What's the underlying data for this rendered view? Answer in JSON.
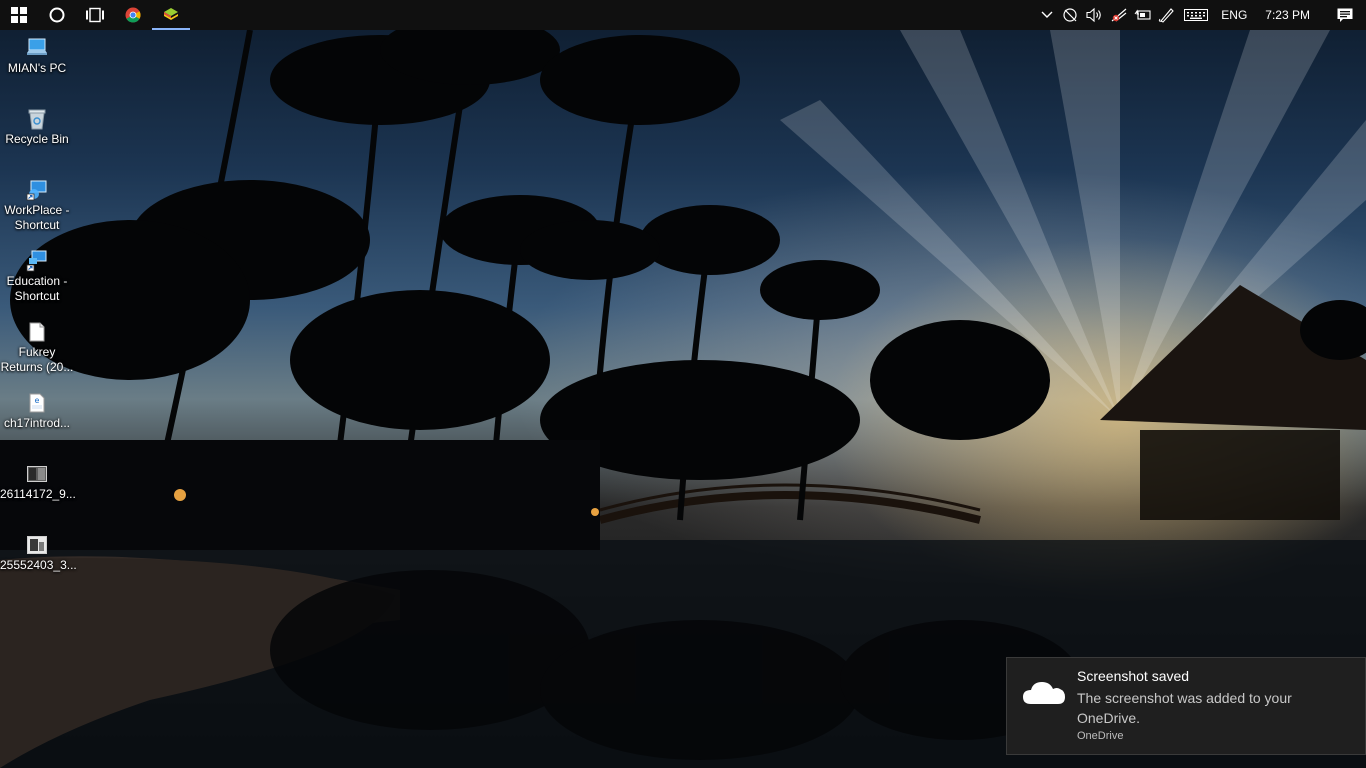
{
  "taskbar": {
    "start_icon": "windows-logo-icon",
    "search_icon": "cortana-circle-icon",
    "taskview_icon": "task-view-icon",
    "pinned": [
      {
        "name": "chrome-icon"
      },
      {
        "name": "bluestacks-icon"
      }
    ],
    "tray": {
      "icons": [
        "chevron-up-icon",
        "network-icon",
        "volume-icon",
        "wifi-off-icon",
        "battery-icon",
        "pen-icon",
        "keyboard-icon"
      ],
      "language": "ENG",
      "time": "7:23 PM",
      "action_center_icon": "action-center-icon"
    }
  },
  "desktop": {
    "icons": [
      {
        "label": "MIAN's  PC",
        "icon": "computer-icon"
      },
      {
        "label": "Recycle Bin",
        "icon": "recycle-bin-icon"
      },
      {
        "label": "WorkPlace - Shortcut",
        "icon": "remote-desktop-icon"
      },
      {
        "label": "Education - Shortcut",
        "icon": "remote-desktop-icon"
      },
      {
        "label": "Fukrey Returns (20...",
        "icon": "document-icon"
      },
      {
        "label": "ch17introd...",
        "icon": "pdf-edge-icon"
      },
      {
        "label": "26114172_9...",
        "icon": "image-thumb-icon"
      },
      {
        "label": "25552403_3...",
        "icon": "image-thumb-icon"
      }
    ]
  },
  "toast": {
    "title": "Screenshot saved",
    "body": "The screenshot was added to your OneDrive.",
    "source": "OneDrive",
    "icon": "onedrive-cloud-icon"
  }
}
